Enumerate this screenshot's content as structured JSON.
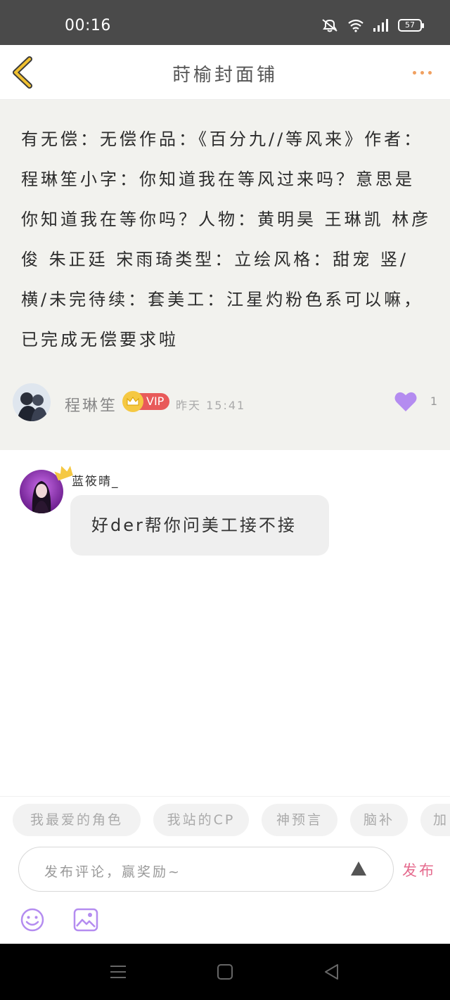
{
  "status_bar": {
    "time": "00:16",
    "battery": "57"
  },
  "nav": {
    "title": "莳榆封面铺"
  },
  "post": {
    "text": "有无偿：无偿作品：《百分九//等风来》作者：程琳笙小字：你知道我在等风过来吗？意思是你知道我在等你吗？人物：黄明昊 王琳凯 林彦俊 朱正廷 宋雨琦类型：立绘风格：甜宠 竖/横/未完待续：套美工：江星灼粉色系可以嘛，已完成无偿要求啦",
    "author": "程琳笙",
    "vip_label": "VIP",
    "time": "昨天 15:41",
    "like_count": "1"
  },
  "comment": {
    "author": "蓝筱晴_",
    "text": "好der帮你问美工接不接"
  },
  "tags": [
    "我最爱的角色",
    "我站的CP",
    "神预言",
    "脑补",
    "加"
  ],
  "composer": {
    "placeholder": "发布评论，赢奖励~",
    "publish_label": "发布"
  },
  "colors": {
    "accent_pink": "#e56b8e",
    "like_purple": "#b48cf0",
    "back_yellow": "#f0c030",
    "vip_red": "#e85a5a"
  },
  "icons": [
    "back-icon",
    "more-icon",
    "heart-icon",
    "crown-icon",
    "send-arrow-icon",
    "emoji-icon",
    "image-icon",
    "menu-icon",
    "home-icon",
    "back-triangle-icon"
  ]
}
